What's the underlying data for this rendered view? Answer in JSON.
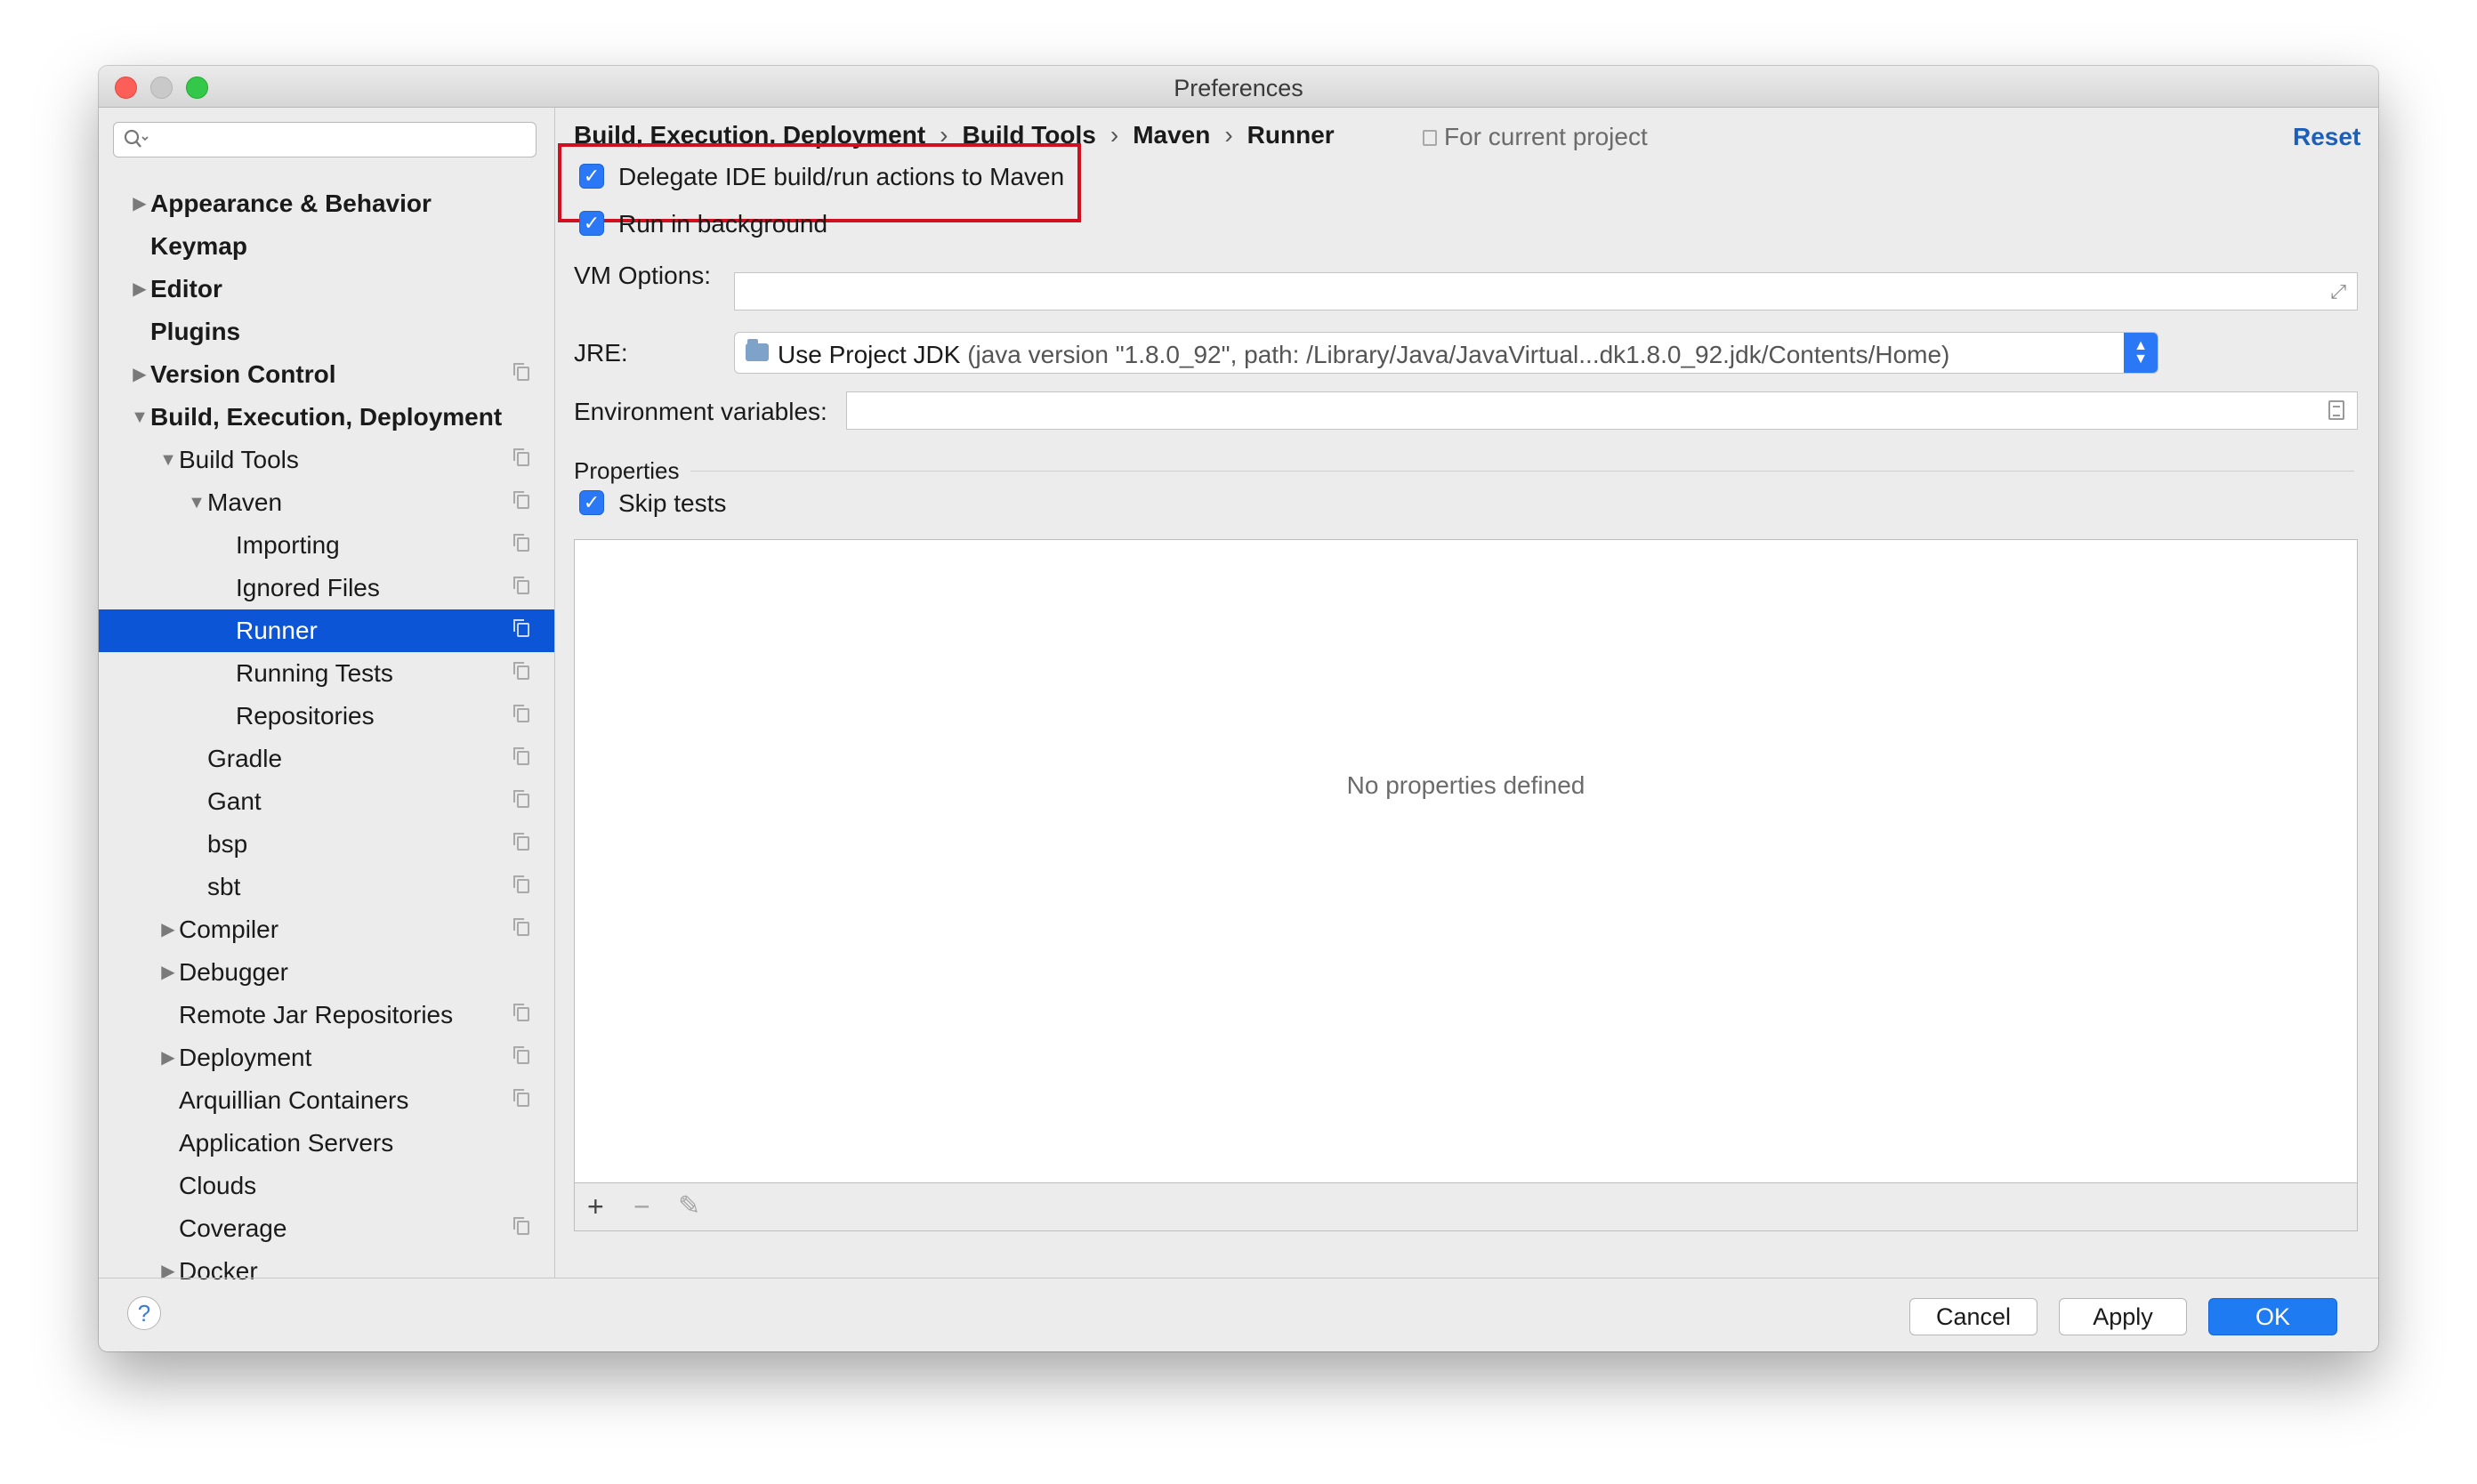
{
  "window": {
    "title": "Preferences"
  },
  "search": {
    "placeholder": "",
    "icon": "search-icon"
  },
  "sidebar": {
    "items": [
      {
        "label": "Appearance & Behavior",
        "bold": true,
        "level": 0,
        "arrow": "collapsed",
        "project": false
      },
      {
        "label": "Keymap",
        "bold": true,
        "level": 0,
        "arrow": "none",
        "project": false
      },
      {
        "label": "Editor",
        "bold": true,
        "level": 0,
        "arrow": "collapsed",
        "project": false
      },
      {
        "label": "Plugins",
        "bold": true,
        "level": 0,
        "arrow": "none",
        "project": false
      },
      {
        "label": "Version Control",
        "bold": true,
        "level": 0,
        "arrow": "collapsed",
        "project": true
      },
      {
        "label": "Build, Execution, Deployment",
        "bold": true,
        "level": 0,
        "arrow": "expanded",
        "project": false
      },
      {
        "label": "Build Tools",
        "bold": false,
        "level": 1,
        "arrow": "expanded",
        "project": true
      },
      {
        "label": "Maven",
        "bold": false,
        "level": 2,
        "arrow": "expanded",
        "project": true
      },
      {
        "label": "Importing",
        "bold": false,
        "level": 3,
        "arrow": "none",
        "project": true
      },
      {
        "label": "Ignored Files",
        "bold": false,
        "level": 3,
        "arrow": "none",
        "project": true
      },
      {
        "label": "Runner",
        "bold": false,
        "level": 3,
        "arrow": "none",
        "project": true,
        "selected": true
      },
      {
        "label": "Running Tests",
        "bold": false,
        "level": 3,
        "arrow": "none",
        "project": true
      },
      {
        "label": "Repositories",
        "bold": false,
        "level": 3,
        "arrow": "none",
        "project": true
      },
      {
        "label": "Gradle",
        "bold": false,
        "level": 2,
        "arrow": "none",
        "project": true
      },
      {
        "label": "Gant",
        "bold": false,
        "level": 2,
        "arrow": "none",
        "project": true
      },
      {
        "label": "bsp",
        "bold": false,
        "level": 2,
        "arrow": "none",
        "project": true
      },
      {
        "label": "sbt",
        "bold": false,
        "level": 2,
        "arrow": "none",
        "project": true
      },
      {
        "label": "Compiler",
        "bold": false,
        "level": 1,
        "arrow": "collapsed",
        "project": true
      },
      {
        "label": "Debugger",
        "bold": false,
        "level": 1,
        "arrow": "collapsed",
        "project": false
      },
      {
        "label": "Remote Jar Repositories",
        "bold": false,
        "level": 1,
        "arrow": "none",
        "project": true
      },
      {
        "label": "Deployment",
        "bold": false,
        "level": 1,
        "arrow": "collapsed",
        "project": true
      },
      {
        "label": "Arquillian Containers",
        "bold": false,
        "level": 1,
        "arrow": "none",
        "project": true
      },
      {
        "label": "Application Servers",
        "bold": false,
        "level": 1,
        "arrow": "none",
        "project": false
      },
      {
        "label": "Clouds",
        "bold": false,
        "level": 1,
        "arrow": "none",
        "project": false
      },
      {
        "label": "Coverage",
        "bold": false,
        "level": 1,
        "arrow": "none",
        "project": true
      },
      {
        "label": "Docker",
        "bold": false,
        "level": 1,
        "arrow": "collapsed",
        "project": false
      }
    ]
  },
  "breadcrumb": {
    "items": [
      "Build, Execution, Deployment",
      "Build Tools",
      "Maven",
      "Runner"
    ],
    "separator": "›"
  },
  "scope": {
    "label": "For current project"
  },
  "reset": {
    "label": "Reset"
  },
  "options": {
    "delegate": {
      "label": "Delegate IDE build/run actions to Maven",
      "checked": true
    },
    "background": {
      "label": "Run in background",
      "checked": true
    }
  },
  "vm_options": {
    "label": "VM Options:",
    "value": ""
  },
  "jre": {
    "label": "JRE:",
    "selected_name": "Use Project JDK",
    "selected_detail": "(java version \"1.8.0_92\", path: /Library/Java/JavaVirtual...dk1.8.0_92.jdk/Contents/Home)"
  },
  "env_vars": {
    "label": "Environment variables:",
    "value": ""
  },
  "properties": {
    "section_label": "Properties",
    "skip_tests": {
      "label": "Skip tests",
      "checked": true
    },
    "empty_text": "No properties defined",
    "toolbar": {
      "add": "+",
      "remove": "−",
      "edit": "✎"
    }
  },
  "footer": {
    "help": "?",
    "cancel": "Cancel",
    "apply": "Apply",
    "ok": "OK"
  },
  "colors": {
    "selection": "#0d55d7",
    "accent": "#2a78f5",
    "highlight_border": "#d20f1e",
    "link": "#1d5fb8"
  }
}
